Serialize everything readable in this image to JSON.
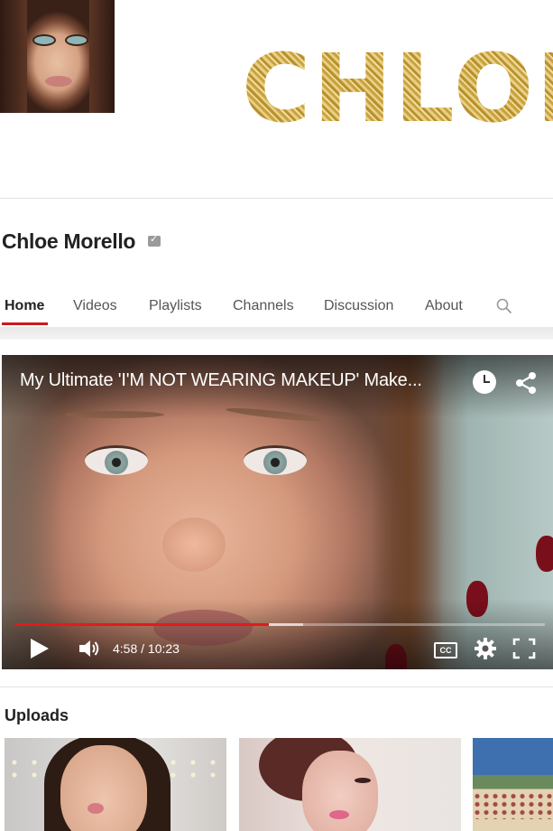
{
  "banner": {
    "title": "CHLOE M"
  },
  "channel": {
    "name": "Chloe Morello"
  },
  "tabs": [
    {
      "label": "Home"
    },
    {
      "label": "Videos"
    },
    {
      "label": "Playlists"
    },
    {
      "label": "Channels"
    },
    {
      "label": "Discussion"
    },
    {
      "label": "About"
    }
  ],
  "player": {
    "title": "My Ultimate 'I'M NOT WEARING MAKEUP' Make...",
    "time": "4:58 / 10:23",
    "played_fraction": 0.48,
    "buffered_fraction": 0.545,
    "cc_label": "CC"
  },
  "uploads": {
    "label": "Uploads"
  },
  "colors": {
    "accent": "#cc181e",
    "progress": "#e21b1b"
  },
  "icons": [
    "verified-icon",
    "search-icon",
    "watch-later-icon",
    "share-icon",
    "play-icon",
    "volume-icon",
    "captions-icon",
    "settings-gear-icon",
    "fullscreen-icon"
  ]
}
